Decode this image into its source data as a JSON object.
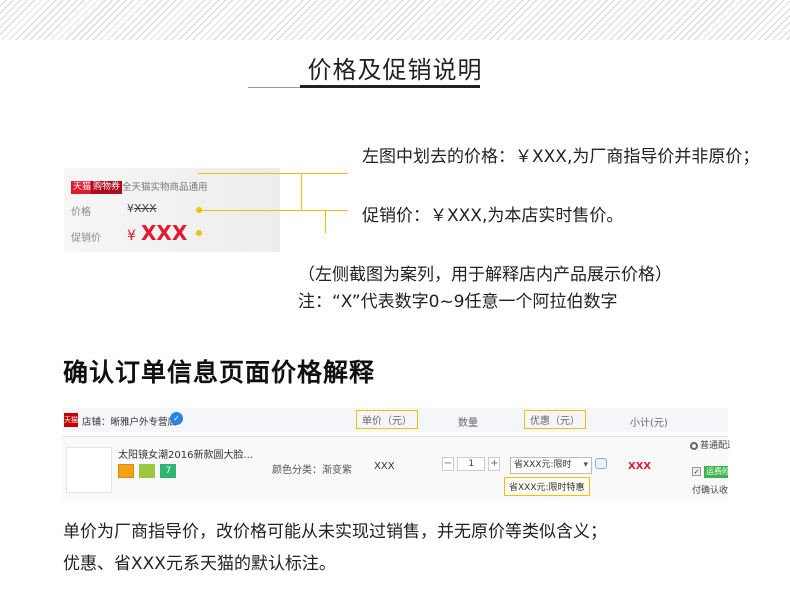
{
  "header": {
    "title": "价格及促销说明"
  },
  "card": {
    "tag_tmall": "天猫",
    "tag_coupon": "购物券",
    "scope_text": "全天猫实物商品通用",
    "orig_label": "价格",
    "orig_currency": "¥",
    "orig_amount": "XXX",
    "sale_label": "促销价",
    "sale_currency": "¥",
    "sale_amount": "XXX"
  },
  "notes": {
    "orig_note": "左图中划去的价格：￥XXX,为厂商指导价并非原价；",
    "sale_note": "促销价：￥XXX,为本店实时售价。"
  },
  "remarks": {
    "r1": "（左侧截图为案列，用于解释店内产品展示价格）",
    "r2": "注：“X”代表数字0~9任意一个阿拉伯数字"
  },
  "section": {
    "title": "确认订单信息页面价格解释"
  },
  "order": {
    "shop_icon": "天猫",
    "shop_name": "店铺：晰雅户外专营店",
    "headers": {
      "unit": "单价（元）",
      "qty": "数量",
      "promo": "优惠（元）",
      "subtotal": "小计(元)"
    },
    "product_name": "太阳镜女潮2016新款圆大脸...",
    "badge_num": "7",
    "variant": "颜色分类：渐变紫",
    "unit_price": "XXX",
    "qty_minus": "−",
    "qty_value": "1",
    "qty_plus": "+",
    "promo_select": "省XXX元:限时",
    "promo_tip": "省XXX元:限时特惠",
    "subtotal": "XXX",
    "ship_option": "普通配送",
    "ship_tag": "运费险",
    "confirm_text": "付确认收货"
  },
  "explain": {
    "e1": "单价为厂商指导价，改价格可能从未实现过销售，并无原价等类似含义；",
    "e2": "优惠、省XXX元系天猫的默认标注。"
  },
  "colors": {
    "accent_red": "#e01b2e",
    "highlight_yellow": "#f2c200"
  }
}
